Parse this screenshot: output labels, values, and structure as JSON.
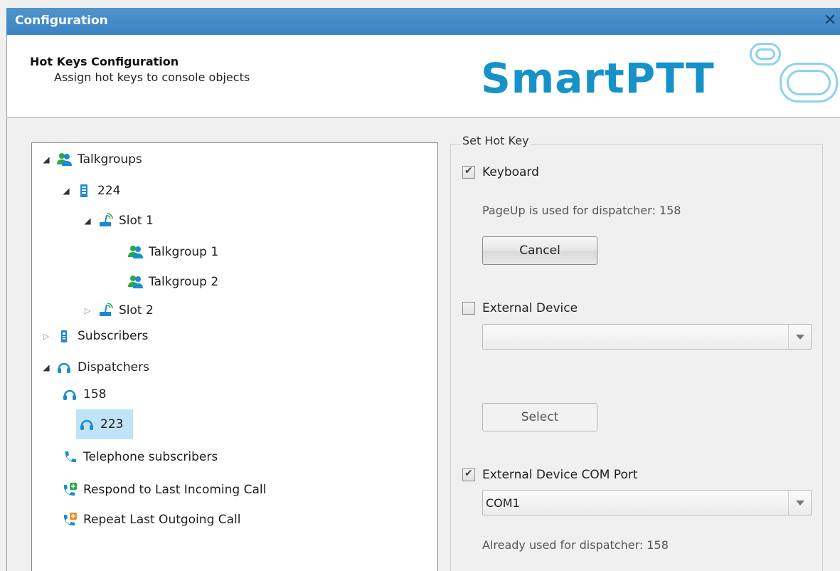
{
  "window": {
    "title": "Configuration",
    "close_glyph": "✕"
  },
  "header": {
    "title": "Hot Keys Configuration",
    "subtitle": "Assign hot keys to console objects",
    "logo_text": "SmartPTT"
  },
  "tree": {
    "talkgroups": "Talkgroups",
    "station": "224",
    "slot1": "Slot 1",
    "talkgroup1": "Talkgroup 1",
    "talkgroup2": "Talkgroup 2",
    "slot2": "Slot 2",
    "subscribers": "Subscribers",
    "dispatchers": "Dispatchers",
    "dispatcher1": "158",
    "dispatcher2": "223",
    "telephone": "Telephone subscribers",
    "respond": "Respond to Last Incoming Call",
    "repeat": "Repeat Last Outgoing Call"
  },
  "hotkey": {
    "legend": "Set Hot Key",
    "keyboard_label": "Keyboard",
    "keyboard_checked": true,
    "keyboard_note": "PageUp is used for dispatcher: 158",
    "cancel_label": "Cancel",
    "external_label": "External Device",
    "external_checked": false,
    "external_value": "",
    "select_label": "Select",
    "com_label": "External Device COM Port",
    "com_checked": true,
    "com_value": "COM1",
    "com_note": "Already used for dispatcher: 158"
  },
  "colors": {
    "accent": "#3b83c4",
    "selection": "#bfe3f7",
    "icon_blue": "#1a8ad4",
    "icon_green": "#2aa84a",
    "logo": "#1592c8"
  }
}
